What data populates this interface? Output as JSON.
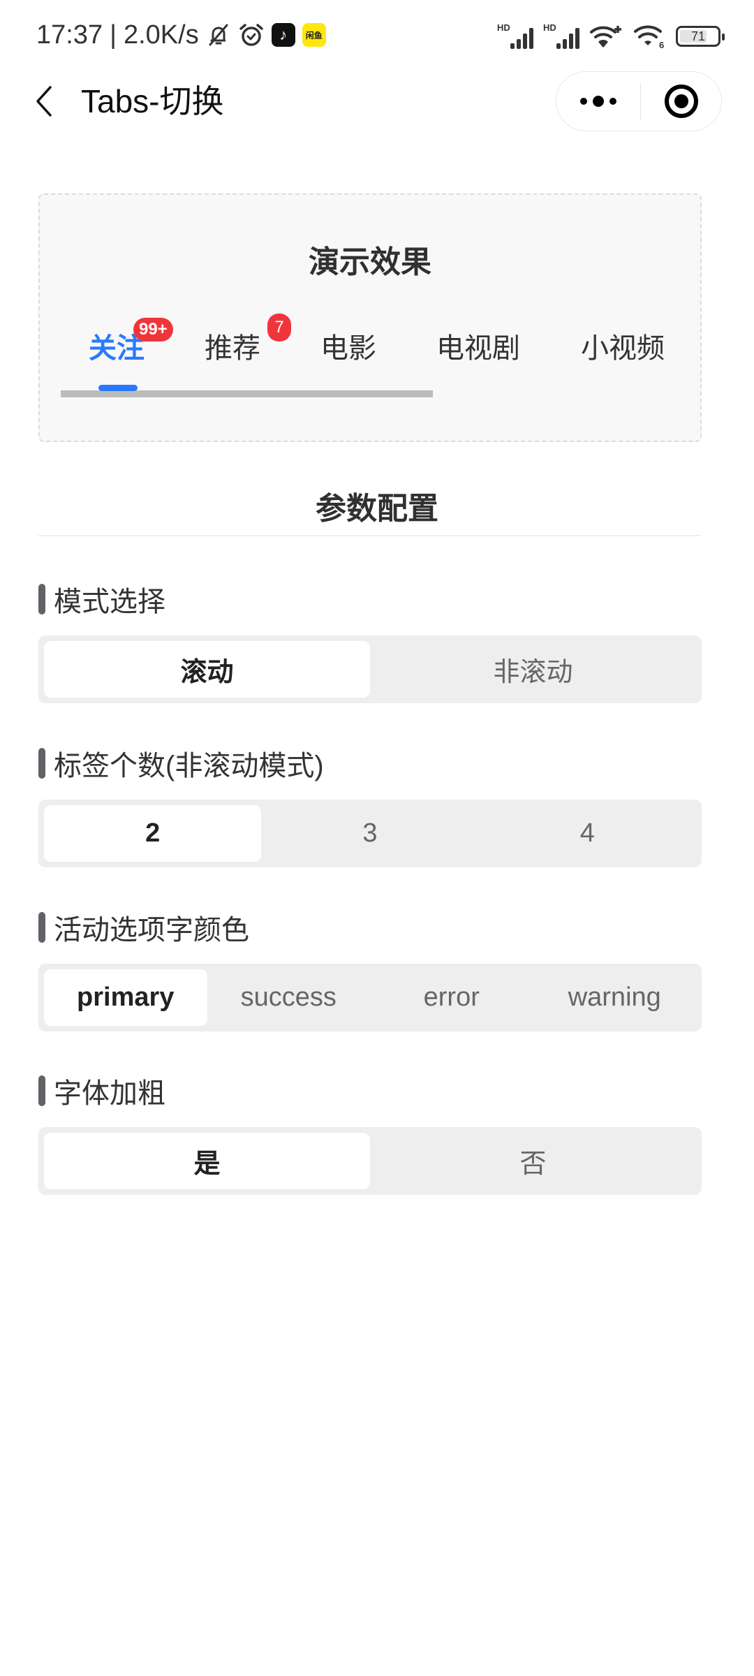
{
  "status_bar": {
    "time": "17:37",
    "separator": "|",
    "network_speed": "2.0K/s",
    "left_icons": [
      "bell-muted-icon",
      "alarm-icon",
      "tiktok-app-icon",
      "xianyu-app-icon"
    ],
    "xianyu_label": "闲鱼",
    "tiktok_glyph": "♪",
    "signal_label_1": "HD",
    "signal_label_2": "HD",
    "wifi6_label": "6",
    "battery_percent": "71"
  },
  "nav": {
    "title": "Tabs-切换",
    "back_icon": "chevron-left-icon",
    "more_icon": "more-dots-icon",
    "close_icon": "target-circle-icon"
  },
  "demo": {
    "title": "演示效果",
    "tabs": [
      {
        "label": "关注",
        "badge": "99+",
        "active": true
      },
      {
        "label": "推荐",
        "badge": "7",
        "active": false
      },
      {
        "label": "电影",
        "badge": null,
        "active": false
      },
      {
        "label": "电视剧",
        "badge": null,
        "active": false
      },
      {
        "label": "小视频",
        "badge": null,
        "active": false
      }
    ],
    "active_color": "#2979ff",
    "badge_color": "#f0353a"
  },
  "config": {
    "title": "参数配置",
    "groups": [
      {
        "label": "模式选择",
        "options": [
          "滚动",
          "非滚动"
        ],
        "selected": 0
      },
      {
        "label": "标签个数(非滚动模式)",
        "options": [
          "2",
          "3",
          "4"
        ],
        "selected": 0
      },
      {
        "label": "活动选项字颜色",
        "options": [
          "primary",
          "success",
          "error",
          "warning"
        ],
        "selected": 0
      },
      {
        "label": "字体加粗",
        "options": [
          "是",
          "否"
        ],
        "selected": 0
      }
    ]
  }
}
